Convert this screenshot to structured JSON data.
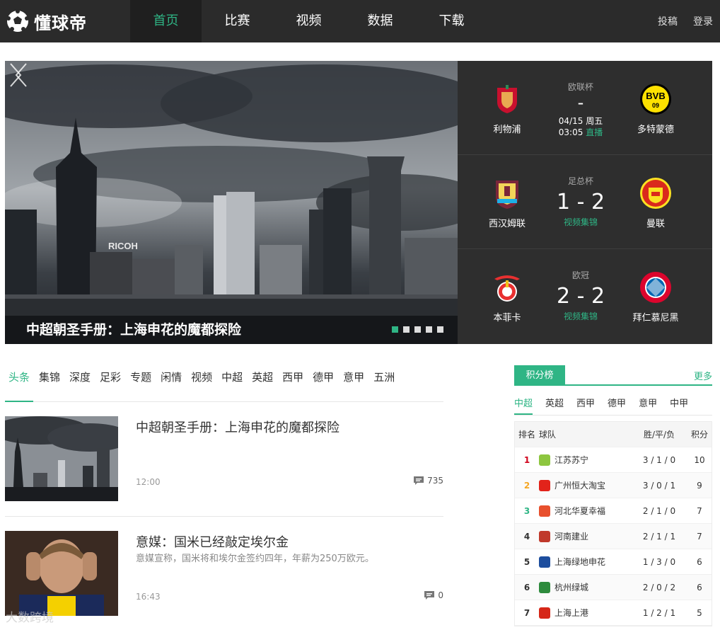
{
  "brand": {
    "name": "懂球帝"
  },
  "nav": [
    {
      "label": "首页",
      "active": true
    },
    {
      "label": "比赛",
      "active": false
    },
    {
      "label": "视频",
      "active": false
    },
    {
      "label": "数据",
      "active": false
    },
    {
      "label": "下载",
      "active": false
    }
  ],
  "top_right": {
    "post": "投稿",
    "login": "登录"
  },
  "hero": {
    "caption": "中超朝圣手册：上海申花的魔都探险",
    "slides": 5,
    "active_slide": 1,
    "billboard": "RICOH"
  },
  "matches": [
    {
      "competition": "欧联杯",
      "home": "利物浦",
      "away": "多特蒙德",
      "score": "-",
      "date": "04/15 周五",
      "time": "03:05",
      "link": "直播",
      "home_color": "#c8102e",
      "away_color": "#fde100"
    },
    {
      "competition": "足总杯",
      "home": "西汉姆联",
      "away": "曼联",
      "score": "1 - 2",
      "link": "视频集锦",
      "home_color": "#7a263a",
      "away_color": "#da291c"
    },
    {
      "competition": "欧冠",
      "home": "本菲卡",
      "away": "拜仁慕尼黑",
      "score": "2 - 2",
      "link": "视频集锦",
      "home_color": "#e83030",
      "away_color": "#dc052d"
    }
  ],
  "tabs": [
    {
      "label": "头条",
      "active": true
    },
    {
      "label": "集锦"
    },
    {
      "label": "深度"
    },
    {
      "label": "足彩"
    },
    {
      "label": "专题"
    },
    {
      "label": "闲情"
    },
    {
      "label": "视频"
    },
    {
      "label": "中超"
    },
    {
      "label": "英超"
    },
    {
      "label": "西甲"
    },
    {
      "label": "德甲"
    },
    {
      "label": "意甲"
    },
    {
      "label": "五洲"
    }
  ],
  "news": [
    {
      "title": "中超朝圣手册：上海申花的魔都探险",
      "desc": "",
      "time": "12:00",
      "comments": "735"
    },
    {
      "title": "意媒：国米已经敲定埃尔金",
      "desc": "意媒宣称，国米将和埃尔金签约四年，年薪为250万欧元。",
      "time": "16:43",
      "comments": "0"
    }
  ],
  "standings": {
    "title": "积分榜",
    "more": "更多",
    "leagues": [
      {
        "label": "中超",
        "active": true
      },
      {
        "label": "英超"
      },
      {
        "label": "西甲"
      },
      {
        "label": "德甲"
      },
      {
        "label": "意甲"
      },
      {
        "label": "中甲"
      }
    ],
    "headers": {
      "rank": "排名",
      "team": "球队",
      "wdl": "胜/平/负",
      "pts": "积分"
    },
    "rows": [
      {
        "rank": "1",
        "team": "江苏苏宁",
        "wdl": "3 / 1 / 0",
        "pts": "10",
        "color": "#8dc63f"
      },
      {
        "rank": "2",
        "team": "广州恒大淘宝",
        "wdl": "3 / 0 / 1",
        "pts": "9",
        "color": "#e2231a"
      },
      {
        "rank": "3",
        "team": "河北华夏幸福",
        "wdl": "2 / 1 / 0",
        "pts": "7",
        "color": "#e8502d"
      },
      {
        "rank": "4",
        "team": "河南建业",
        "wdl": "2 / 1 / 1",
        "pts": "7",
        "color": "#c0392b"
      },
      {
        "rank": "5",
        "team": "上海绿地申花",
        "wdl": "1 / 3 / 0",
        "pts": "6",
        "color": "#1d4e9e"
      },
      {
        "rank": "6",
        "team": "杭州绿城",
        "wdl": "2 / 0 / 2",
        "pts": "6",
        "color": "#2e8b3d"
      },
      {
        "rank": "7",
        "team": "上海上港",
        "wdl": "1 / 2 / 1",
        "pts": "5",
        "color": "#d62718"
      }
    ]
  },
  "watermark": "大数跨境"
}
